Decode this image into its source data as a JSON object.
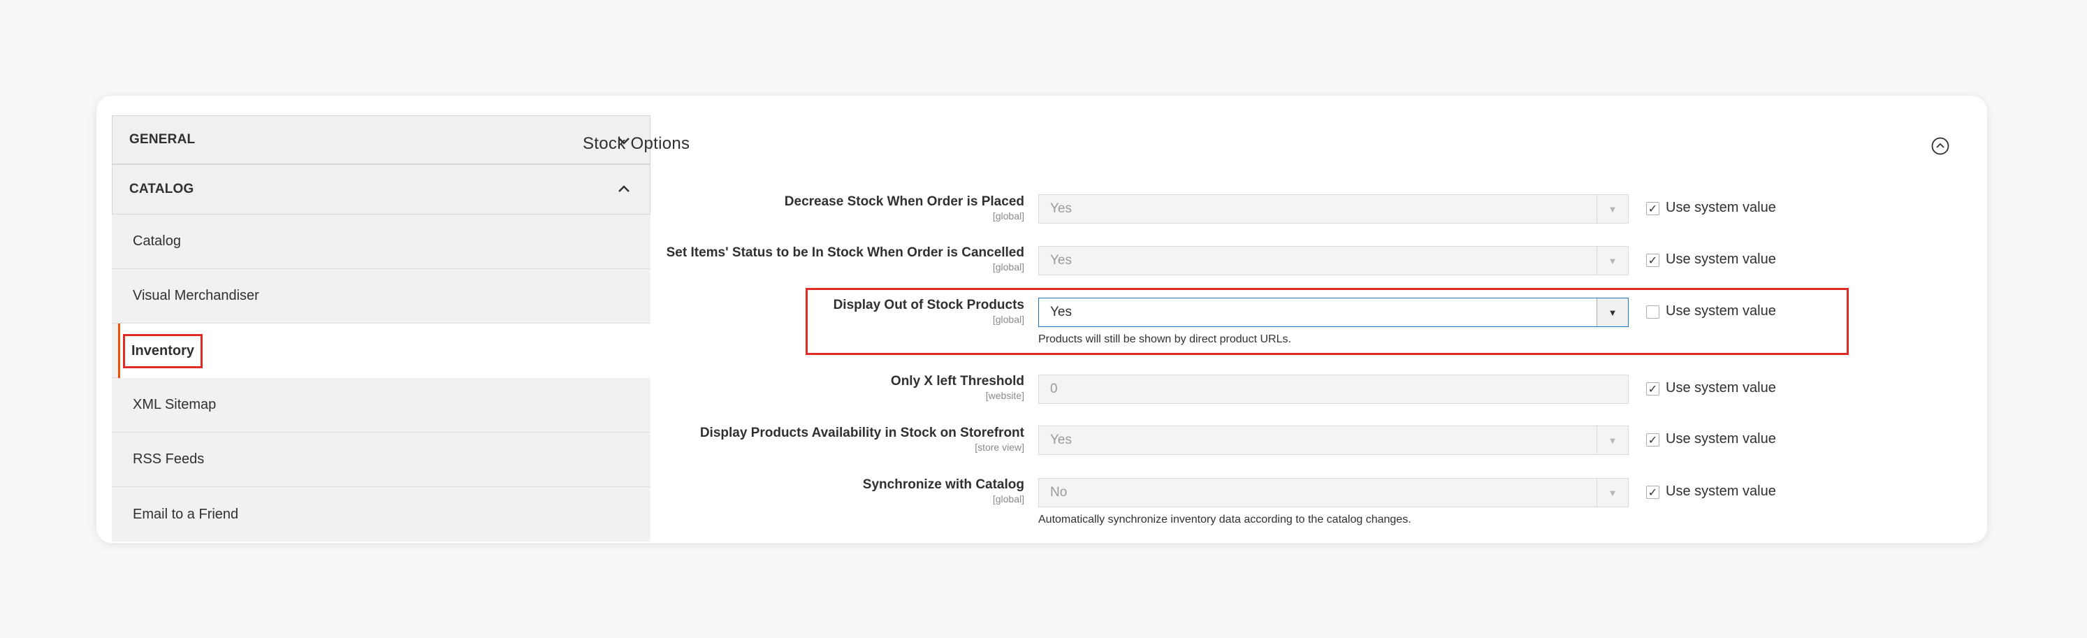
{
  "sidebar": {
    "general": {
      "label": "GENERAL",
      "icon": "chevron-down-icon"
    },
    "catalog": {
      "label": "CATALOG",
      "icon": "chevron-up-icon"
    },
    "items": [
      {
        "label": "Catalog"
      },
      {
        "label": "Visual Merchandiser"
      },
      {
        "label": "Inventory",
        "active": true
      },
      {
        "label": "XML Sitemap"
      },
      {
        "label": "RSS Feeds"
      },
      {
        "label": "Email to a Friend"
      }
    ]
  },
  "main": {
    "section_title": "Stock Options",
    "collapse_icon": "collapse-circle-icon",
    "use_system_label": "Use system value",
    "fields": [
      {
        "label": "Decrease Stock When Order is Placed",
        "scope": "[global]",
        "value": "Yes",
        "use_system": true
      },
      {
        "label": "Set Items' Status to be In Stock When Order is Cancelled",
        "scope": "[global]",
        "value": "Yes",
        "use_system": true
      },
      {
        "label": "Display Out of Stock Products",
        "scope": "[global]",
        "value": "Yes",
        "use_system": false,
        "note": "Products will still be shown by direct product URLs."
      },
      {
        "label": "Only X left Threshold",
        "scope": "[website]",
        "value": "0",
        "use_system": true
      },
      {
        "label": "Display Products Availability in Stock on Storefront",
        "scope": "[store view]",
        "value": "Yes",
        "use_system": true
      },
      {
        "label": "Synchronize with Catalog",
        "scope": "[global]",
        "value": "No",
        "use_system": true,
        "note": "Automatically synchronize inventory data according to the catalog changes."
      }
    ]
  },
  "colors": {
    "highlight": "#e02b27",
    "active_border": "#eb5202",
    "focus": "#1979c3"
  }
}
